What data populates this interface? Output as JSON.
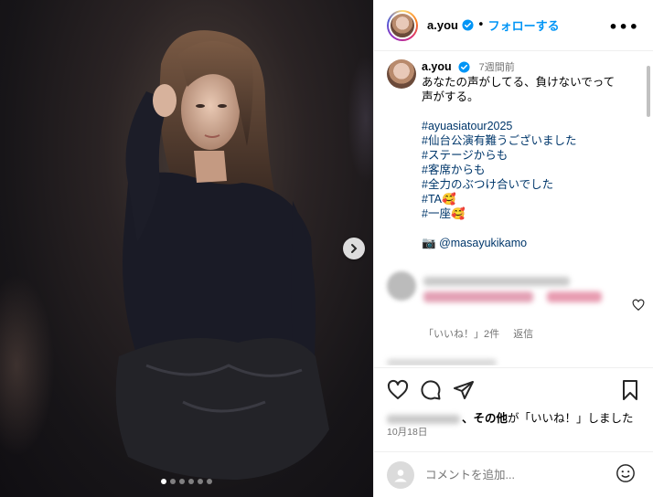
{
  "post": {
    "username": "a.you",
    "follow_label": "フォローする",
    "separator": "•",
    "more_label": "•••",
    "time_ago": "7週間前",
    "caption_lines": [
      "あなたの声がしてる、負けないでって",
      "声がする。"
    ],
    "hashtags": [
      "#ayuasiatour2025",
      "#仙台公演有難うございました",
      "#ステージからも",
      "#客席からも",
      "#全力のぶつけ合いでした",
      "#TA🥰",
      "#一座🥰"
    ],
    "photo_credit_icon": "📷",
    "photo_credit": "@masayukikamo",
    "carousel_count": 6,
    "carousel_active_index": 0
  },
  "comment": {
    "likes_text": "「いいね！」2件",
    "reply_label": "返信"
  },
  "likes": {
    "suffix_bold": "、その他",
    "suffix_text": "が「いいね！」しました"
  },
  "date": "10月18日",
  "add_comment": {
    "placeholder": "コメントを追加..."
  },
  "colors": {
    "accent": "#0095f6",
    "link": "#00376b",
    "muted": "#737373"
  }
}
